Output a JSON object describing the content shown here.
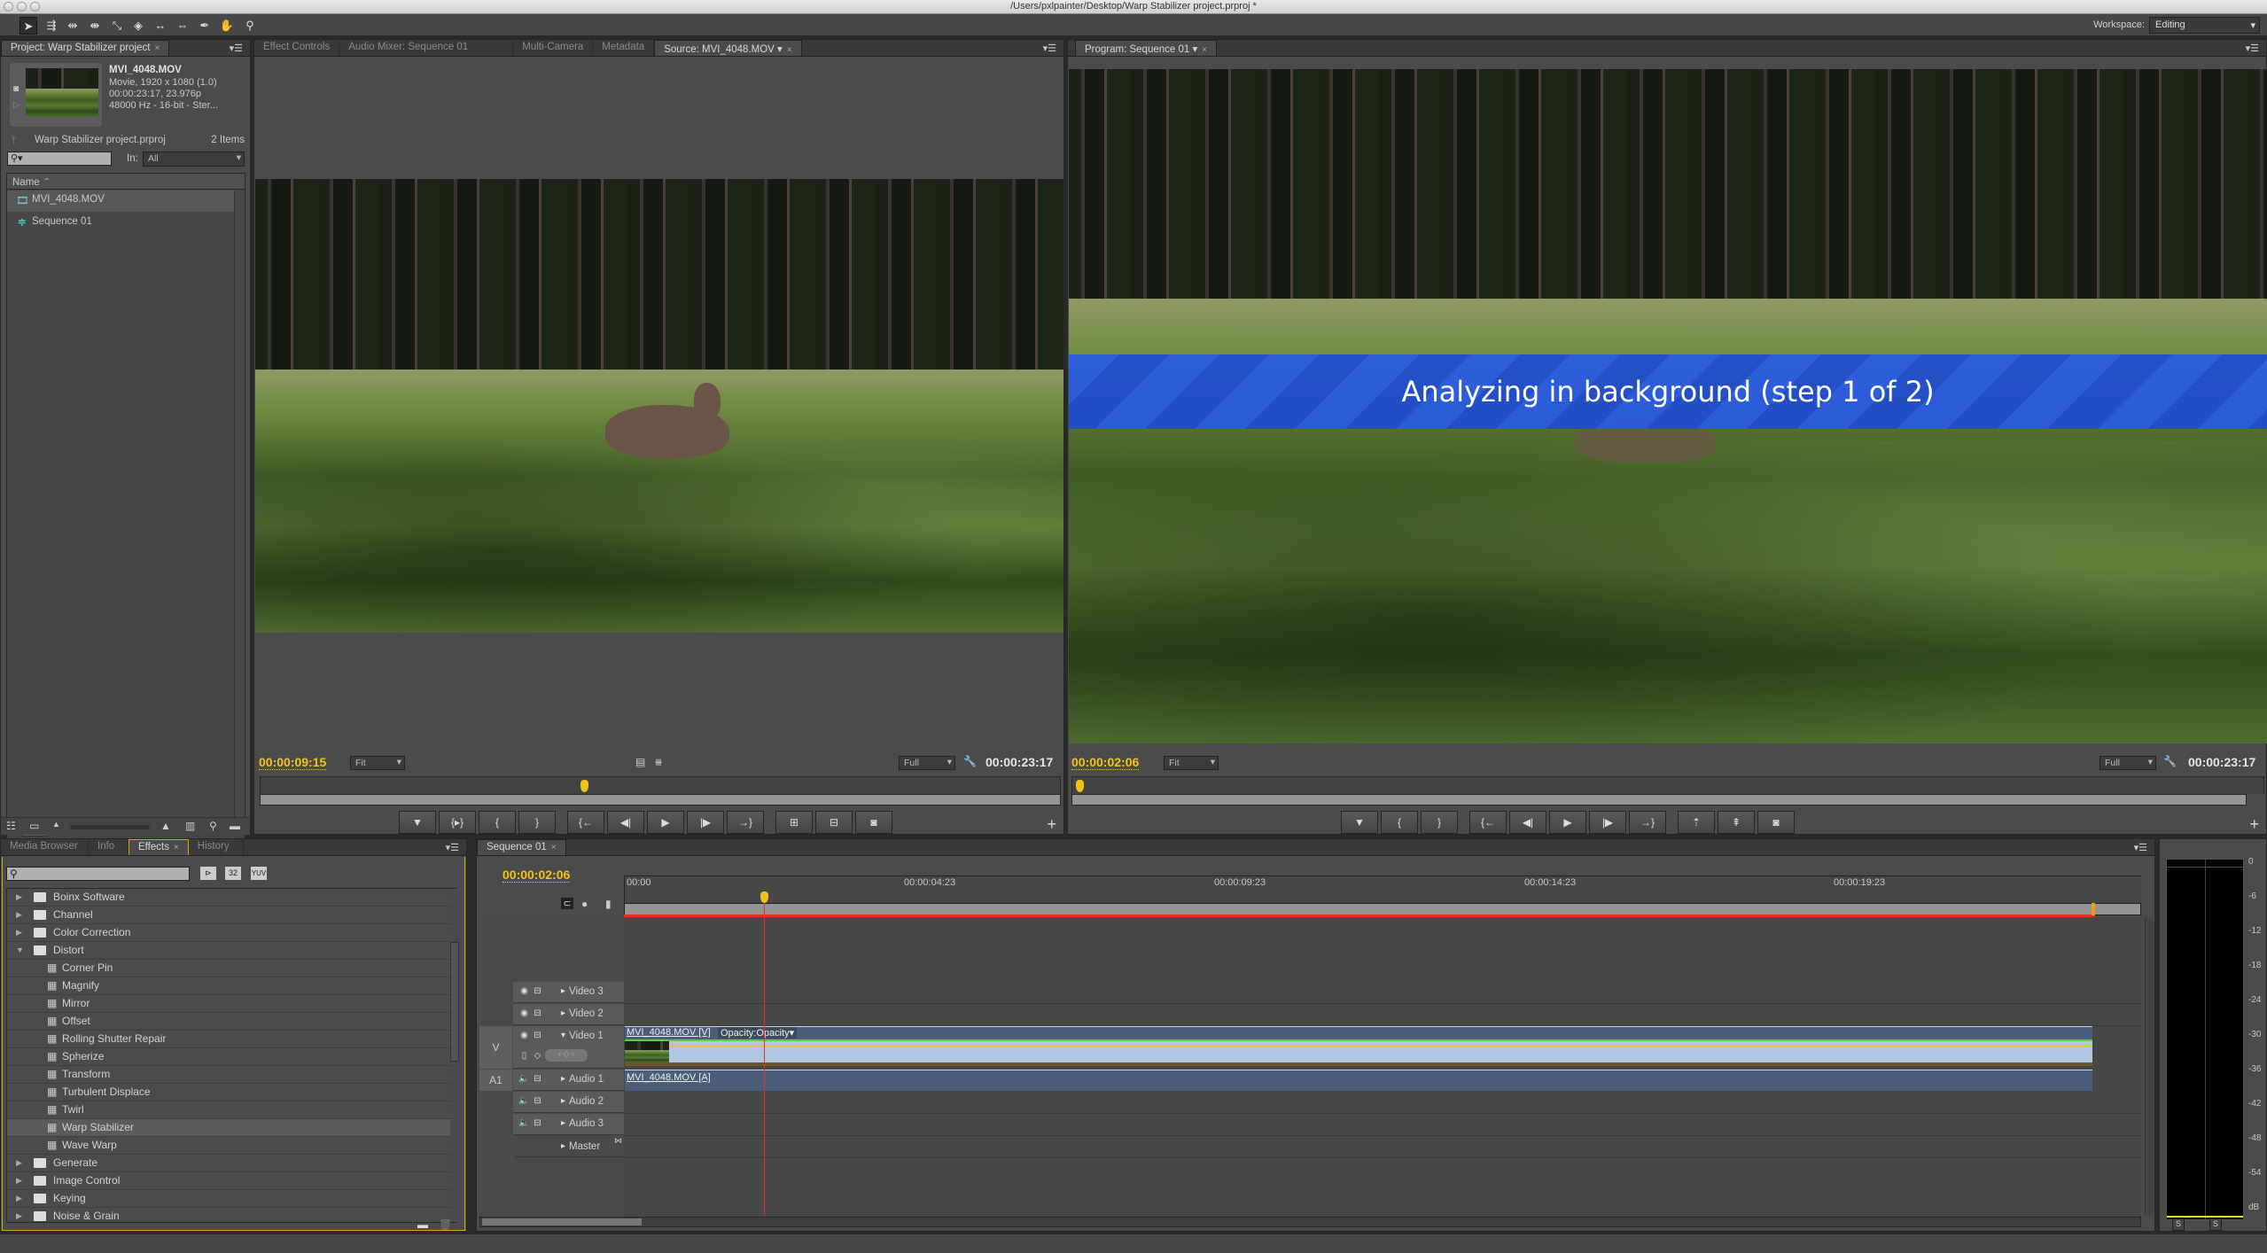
{
  "window": {
    "title": "/Users/pxlpainter/Desktop/Warp Stabilizer project.prproj *"
  },
  "toolbar": {
    "tools": [
      "selection-tool",
      "track-select-tool",
      "ripple-edit-tool",
      "rolling-edit-tool",
      "rate-stretch-tool",
      "razor-tool",
      "slip-tool",
      "slide-tool",
      "pen-tool",
      "hand-tool",
      "zoom-tool"
    ],
    "workspace_label": "Workspace:",
    "workspace_value": "Editing"
  },
  "project": {
    "tab": "Project: Warp Stabilizer project",
    "clip_name": "MVI_4048.MOV",
    "clip_info1": "Movie, 1920 x 1080 (1.0)",
    "clip_info2": "00:00:23:17, 23.976p",
    "clip_info3": "48000 Hz - 16-bit - Ster...",
    "file": "Warp Stabilizer project.prproj",
    "count": "2 Items",
    "search_placeholder": "",
    "in_label": "In:",
    "in_value": "All",
    "column_name": "Name",
    "items": [
      {
        "label": "MVI_4048.MOV",
        "icon": "movie-clip-icon"
      },
      {
        "label": "Sequence 01",
        "icon": "sequence-icon"
      }
    ]
  },
  "source": {
    "tabs": [
      "Effect Controls",
      "Audio Mixer: Sequence 01",
      "Multi-Camera",
      "Metadata",
      "Source: MVI_4048.MOV"
    ],
    "timecode": "00:00:09:15",
    "zoom": "Fit",
    "resolution": "Full",
    "duration": "00:00:23:17",
    "playhead_fraction": 0.405,
    "buttons": [
      "add-marker",
      "mark-in-out",
      "mark-in",
      "mark-out",
      "go-to-in",
      "step-back",
      "play",
      "step-forward",
      "go-to-out",
      "insert",
      "overwrite",
      "export-frame"
    ],
    "button_glyphs": [
      "▼",
      "{▸}",
      "{",
      "}",
      "{←",
      "◀|",
      "▶",
      "|▶",
      "→}",
      "⊞",
      "⊟",
      "◙"
    ]
  },
  "program": {
    "tab": "Program: Sequence 01",
    "overlay": "Analyzing in background (step 1 of 2)",
    "timecode": "00:00:02:06",
    "zoom": "Fit",
    "resolution": "Full",
    "duration": "00:00:23:17",
    "playhead_fraction": 0.003,
    "buttons": [
      "add-marker",
      "mark-in",
      "mark-out",
      "go-to-in",
      "step-back",
      "play",
      "step-forward",
      "go-to-out",
      "lift",
      "extract",
      "export-frame"
    ],
    "button_glyphs": [
      "▼",
      "{",
      "}",
      "{←",
      "◀|",
      "▶",
      "|▶",
      "→}",
      "⇡",
      "⇞",
      "◙"
    ],
    "accent": "#2a5ae0"
  },
  "effects": {
    "tabs": [
      "Media Browser",
      "Info",
      "Effects",
      "History"
    ],
    "active_tab": "Effects",
    "filter_buttons": [
      "accelerated-effects",
      "32",
      "YUV"
    ],
    "items": [
      {
        "label": "Boinx Software",
        "type": "folder",
        "expanded": false
      },
      {
        "label": "Channel",
        "type": "folder",
        "expanded": false
      },
      {
        "label": "Color Correction",
        "type": "folder",
        "expanded": false
      },
      {
        "label": "Distort",
        "type": "folder",
        "expanded": true
      },
      {
        "label": "Corner Pin",
        "type": "effect"
      },
      {
        "label": "Magnify",
        "type": "effect"
      },
      {
        "label": "Mirror",
        "type": "effect"
      },
      {
        "label": "Offset",
        "type": "effect"
      },
      {
        "label": "Rolling Shutter Repair",
        "type": "effect"
      },
      {
        "label": "Spherize",
        "type": "effect"
      },
      {
        "label": "Transform",
        "type": "effect"
      },
      {
        "label": "Turbulent Displace",
        "type": "effect"
      },
      {
        "label": "Twirl",
        "type": "effect"
      },
      {
        "label": "Warp Stabilizer",
        "type": "effect",
        "hovered": true
      },
      {
        "label": "Wave Warp",
        "type": "effect"
      },
      {
        "label": "Generate",
        "type": "folder",
        "expanded": false
      },
      {
        "label": "Image Control",
        "type": "folder",
        "expanded": false
      },
      {
        "label": "Keying",
        "type": "folder",
        "expanded": false
      },
      {
        "label": "Noise & Grain",
        "type": "folder",
        "expanded": false
      }
    ]
  },
  "timeline": {
    "tab": "Sequence 01",
    "timecode": "00:00:02:06",
    "ruler": [
      "00:00",
      "00:00:04:23",
      "00:00:09:23",
      "00:00:14:23",
      "00:00:19:23"
    ],
    "tracks": {
      "video3": "Video 3",
      "video2": "Video 2",
      "video1": "Video 1",
      "audio1": "Audio 1",
      "audio2": "Audio 2",
      "audio3": "Audio 3",
      "master": "Master",
      "v_target": "V",
      "a_target": "A1"
    },
    "video_clip": "MVI_4048.MOV [V]",
    "video_clip_fx": "Opacity:Opacity",
    "audio_clip": "MVI_4048.MOV [A]"
  },
  "meter": {
    "scale": [
      "0",
      "-6",
      "-12",
      "-18",
      "-24",
      "-30",
      "-36",
      "-42",
      "-48",
      "-54",
      "dB"
    ],
    "solo": [
      "S",
      "S"
    ]
  }
}
